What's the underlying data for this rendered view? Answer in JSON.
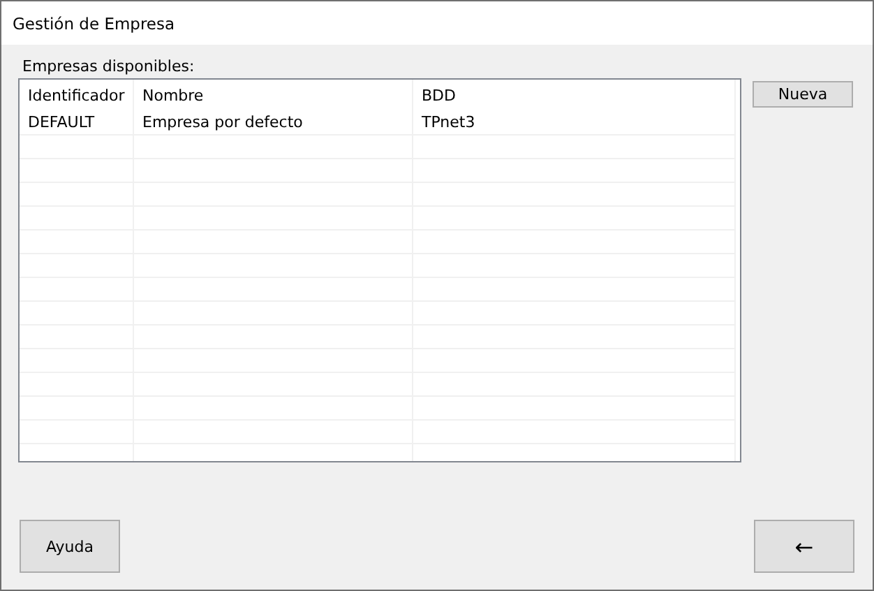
{
  "window": {
    "title": "Gestión de Empresa"
  },
  "list_label": "Empresas disponibles:",
  "table": {
    "columns": [
      "Identificador",
      "Nombre",
      "BDD"
    ],
    "rows": [
      {
        "cells": [
          "DEFAULT",
          "Empresa por defecto",
          "TPnet3"
        ],
        "selected": false
      }
    ]
  },
  "side_buttons": [
    "Nueva"
  ],
  "footer_buttons": [
    {
      "label": "Ayuda"
    },
    {
      "label": "←"
    }
  ]
}
